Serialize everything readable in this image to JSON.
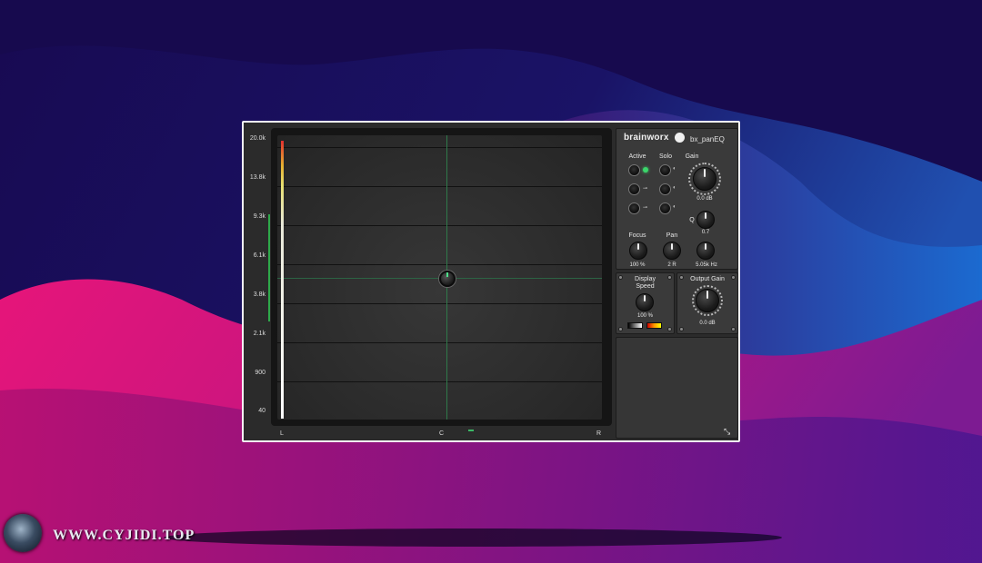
{
  "colors": {
    "bg_dark": "#1b0d5c",
    "bg_blue": "#1f5fb8",
    "bg_magenta": "#e0127a",
    "bg_purple": "#6a1a7a",
    "accent_green": "#3bd66b",
    "meter_red": "#e53030",
    "meter_yellow": "#e5b030"
  },
  "watermark": {
    "text": "WWW.CYJIDI.TOP",
    "icon": "spiky-sphere-logo-icon"
  },
  "plugin": {
    "brand": "brainworx",
    "brand_icon": "brainworx-logo-icon",
    "product": "bx_panEQ",
    "display": {
      "y_labels": [
        "20.0k",
        "13.8k",
        "9.3k",
        "6.1k",
        "3.8k",
        "2.1k",
        "900",
        "40"
      ],
      "x_labels": [
        "L",
        "C",
        "R"
      ]
    },
    "band": {
      "active_label": "Active",
      "solo_label": "Solo",
      "gain_label": "Gain",
      "gain_value": "0.0 dB",
      "q_label": "Q",
      "q_value": "0.7",
      "focus_label": "Focus",
      "focus_value": "100 %",
      "pan_label": "Pan",
      "pan_value": "2 R",
      "freq_value": "5.05k Hz"
    },
    "display_speed": {
      "label_line1": "Display",
      "label_line2": "Speed",
      "value": "100 %"
    },
    "output_gain": {
      "label": "Output Gain",
      "value": "0.0 dB"
    },
    "resize_icon": "resize-arrows-icon"
  }
}
